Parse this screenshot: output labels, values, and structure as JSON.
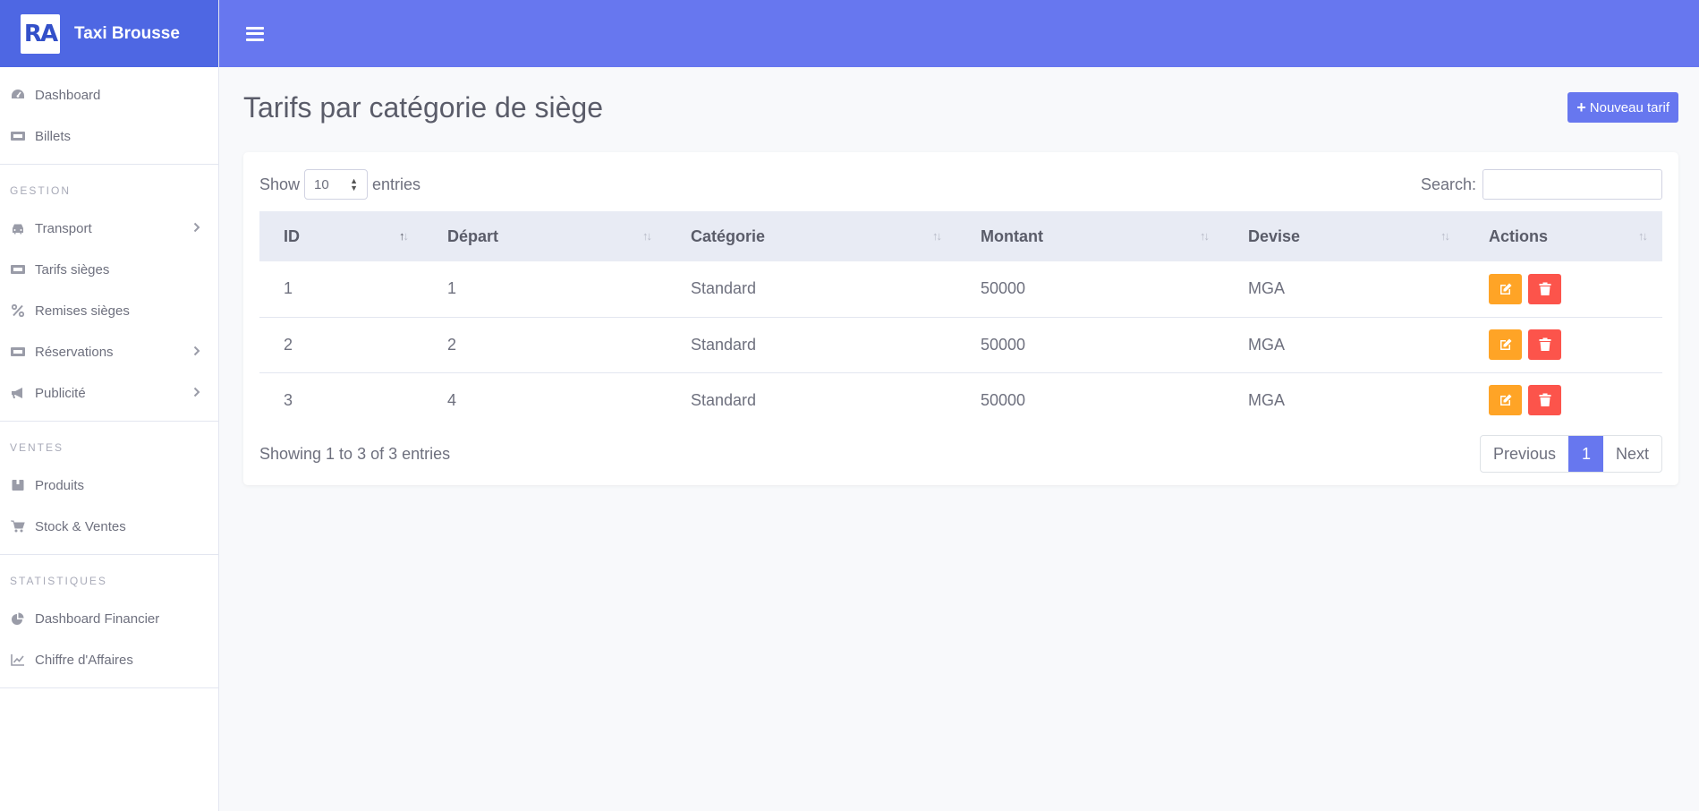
{
  "brand": {
    "logo_text": "RA",
    "name": "Taxi Brousse"
  },
  "sidebar": {
    "top_items": [
      {
        "label": "Dashboard",
        "icon": "dashboard-icon"
      },
      {
        "label": "Billets",
        "icon": "ticket-icon"
      }
    ],
    "sections": [
      {
        "heading": "Gestion",
        "items": [
          {
            "label": "Transport",
            "icon": "car-icon",
            "has_submenu": true
          },
          {
            "label": "Tarifs sièges",
            "icon": "ticket-icon",
            "has_submenu": false
          },
          {
            "label": "Remises sièges",
            "icon": "percent-icon",
            "has_submenu": false
          },
          {
            "label": "Réservations",
            "icon": "ticket-icon",
            "has_submenu": true
          },
          {
            "label": "Publicité",
            "icon": "megaphone-icon",
            "has_submenu": true
          }
        ]
      },
      {
        "heading": "Ventes",
        "items": [
          {
            "label": "Produits",
            "icon": "box-icon",
            "has_submenu": false
          },
          {
            "label": "Stock & Ventes",
            "icon": "cart-icon",
            "has_submenu": false
          }
        ]
      },
      {
        "heading": "Statistiques",
        "items": [
          {
            "label": "Dashboard Financier",
            "icon": "pie-chart-icon",
            "has_submenu": false
          },
          {
            "label": "Chiffre d'Affaires",
            "icon": "line-chart-icon",
            "has_submenu": false
          }
        ]
      }
    ]
  },
  "page": {
    "title": "Tarifs par catégorie de siège",
    "new_button": "Nouveau tarif"
  },
  "table_controls": {
    "show_label": "Show",
    "entries_value": "10",
    "entries_label": "entries",
    "search_label": "Search:",
    "search_value": ""
  },
  "table": {
    "columns": [
      "ID",
      "Départ",
      "Catégorie",
      "Montant",
      "Devise",
      "Actions"
    ],
    "rows": [
      {
        "id": "1",
        "depart": "1",
        "categorie": "Standard",
        "montant": "50000",
        "devise": "MGA"
      },
      {
        "id": "2",
        "depart": "2",
        "categorie": "Standard",
        "montant": "50000",
        "devise": "MGA"
      },
      {
        "id": "3",
        "depart": "4",
        "categorie": "Standard",
        "montant": "50000",
        "devise": "MGA"
      }
    ]
  },
  "footer": {
    "info": "Showing 1 to 3 of 3 entries",
    "previous": "Previous",
    "current_page": "1",
    "next": "Next"
  },
  "colors": {
    "brand_bg": "#4e67e3",
    "topbar_bg": "#6777ef",
    "edit_button": "#ffa426",
    "delete_button": "#fc544b"
  }
}
